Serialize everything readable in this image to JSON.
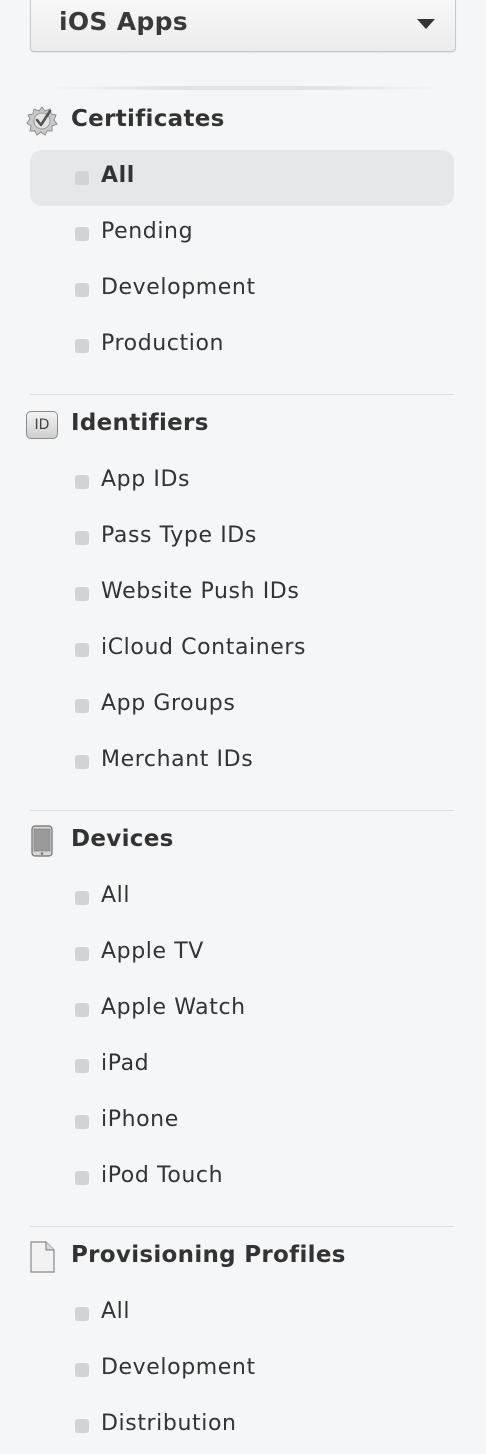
{
  "platform_selector": {
    "value": "iOS Apps"
  },
  "sections": {
    "certificates": {
      "title": "Certificates",
      "icon": "certificate-badge-icon",
      "items": [
        "All",
        "Pending",
        "Development",
        "Production"
      ],
      "selected": "All"
    },
    "identifiers": {
      "title": "Identifiers",
      "icon": "id-badge-icon",
      "badge_text": "ID",
      "items": [
        "App IDs",
        "Pass Type IDs",
        "Website Push IDs",
        "iCloud Containers",
        "App Groups",
        "Merchant IDs"
      ]
    },
    "devices": {
      "title": "Devices",
      "icon": "device-icon",
      "items": [
        "All",
        "Apple TV",
        "Apple Watch",
        "iPad",
        "iPhone",
        "iPod Touch"
      ]
    },
    "provisioning_profiles": {
      "title": "Provisioning Profiles",
      "icon": "document-icon",
      "items": [
        "All",
        "Development",
        "Distribution"
      ]
    }
  },
  "colors": {
    "background": "#f5f6f7",
    "selected_item": "#e6e7e8",
    "bullet": "#d2d3d4",
    "text": "#333333"
  }
}
